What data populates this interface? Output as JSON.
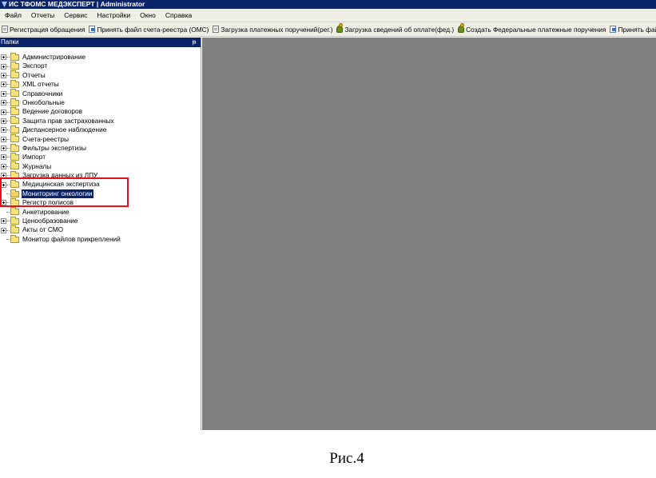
{
  "window": {
    "title": "ИС ТФОМС МЕДЭКСПЕРТ | Administrator"
  },
  "menu": [
    "Файл",
    "Отчеты",
    "Сервис",
    "Настройки",
    "Окно",
    "Справка"
  ],
  "toolbar": [
    {
      "label": "Регистрация обращения",
      "icon": "document-icon"
    },
    {
      "label": "Принять файл счета-реестра (ОМС)",
      "icon": "import-file-icon"
    },
    {
      "label": "Загрузка платежных поручений(рег.)",
      "icon": "document-icon"
    },
    {
      "label": "Загрузка сведений об оплате(фед.)",
      "icon": "user-icon"
    },
    {
      "label": "Создать Федеральные платежные поручения",
      "icon": "user-icon"
    },
    {
      "label": "Принять файл на",
      "icon": "import-file-icon"
    }
  ],
  "folders_panel": {
    "title": "Папки",
    "pin_symbol": "ᵽ",
    "items": [
      {
        "label": "Администрирование",
        "expandable": true,
        "selected": false
      },
      {
        "label": "Экспорт",
        "expandable": true,
        "selected": false
      },
      {
        "label": "Отчеты",
        "expandable": true,
        "selected": false
      },
      {
        "label": "XML отчеты",
        "expandable": true,
        "selected": false
      },
      {
        "label": "Справочники",
        "expandable": true,
        "selected": false
      },
      {
        "label": "Онкобольные",
        "expandable": true,
        "selected": false
      },
      {
        "label": "Ведение договоров",
        "expandable": true,
        "selected": false
      },
      {
        "label": "Защита прав застрахованных",
        "expandable": true,
        "selected": false
      },
      {
        "label": "Диспансерное наблюдение",
        "expandable": true,
        "selected": false
      },
      {
        "label": "Счета-реестры",
        "expandable": true,
        "selected": false
      },
      {
        "label": "Фильтры экспертизы",
        "expandable": true,
        "selected": false
      },
      {
        "label": "Импорт",
        "expandable": true,
        "selected": false
      },
      {
        "label": "Журналы",
        "expandable": true,
        "selected": false
      },
      {
        "label": "Загрузка данных из ЛПУ",
        "expandable": true,
        "selected": false
      },
      {
        "label": "Медицинская экспертиза",
        "expandable": true,
        "selected": false
      },
      {
        "label": "Мониторинг онкологии",
        "expandable": false,
        "selected": true
      },
      {
        "label": "Регистр полисов",
        "expandable": true,
        "selected": false
      },
      {
        "label": "Анкетирование",
        "expandable": false,
        "selected": false
      },
      {
        "label": "Ценообразование",
        "expandable": true,
        "selected": false
      },
      {
        "label": "Акты от СМО",
        "expandable": true,
        "selected": false
      },
      {
        "label": "Монитор файлов прикреплений",
        "expandable": false,
        "selected": false
      }
    ]
  },
  "colors": {
    "title_bar": "#0a246a",
    "workspace": "#808080",
    "highlight": "#e8101a",
    "folder": "#f8e27a"
  },
  "caption": "Рис.4"
}
